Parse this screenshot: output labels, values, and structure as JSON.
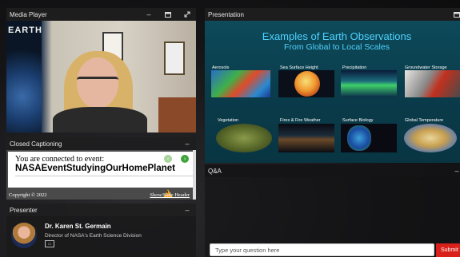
{
  "media_player": {
    "title": "Media Player",
    "poster_text": "EARTH"
  },
  "closed_captioning": {
    "title": "Closed Captioning",
    "connected_text": "You are connected to event:",
    "event_name": "NASAEventStudyingOurHomePlanet",
    "copyright": "Copyright © 2022",
    "show_hide": "Show/Hide Header",
    "warning_symbol": "!"
  },
  "presenter": {
    "title": "Presenter",
    "name": "Dr. Karen St. Germain",
    "role": "Director of NASA's Earth Science Division",
    "badge": "▭"
  },
  "presentation": {
    "title": "Presentation",
    "slide_title": "Examples of Earth Observations",
    "slide_subtitle": "From Global to Local Scales",
    "tiles": [
      {
        "label": "Aerosols",
        "icon": "aerosols-map"
      },
      {
        "label": "Sea Surface Height",
        "icon": "sea-surface-globe"
      },
      {
        "label": "Precipitation",
        "icon": "precipitation-map"
      },
      {
        "label": "Groundwater Storage",
        "icon": "groundwater-map"
      },
      {
        "label": "Vegetation",
        "icon": "vegetation-map"
      },
      {
        "label": "Fires & Fire Weather",
        "icon": "fires-map"
      },
      {
        "label": "Surface Biology",
        "icon": "surface-biology-map"
      },
      {
        "label": "Global Temperature",
        "icon": "temperature-map"
      }
    ]
  },
  "qa": {
    "title": "Q&A",
    "input_placeholder": "Type your question here",
    "submit_label": "Submit"
  },
  "icons": {
    "minimize": "minimize-icon",
    "maximize": "maximize-icon",
    "expand": "expand-icon"
  },
  "colors": {
    "slide_title": "#4fd2ff",
    "submit": "#d9211c",
    "warning": "#f0a020"
  }
}
